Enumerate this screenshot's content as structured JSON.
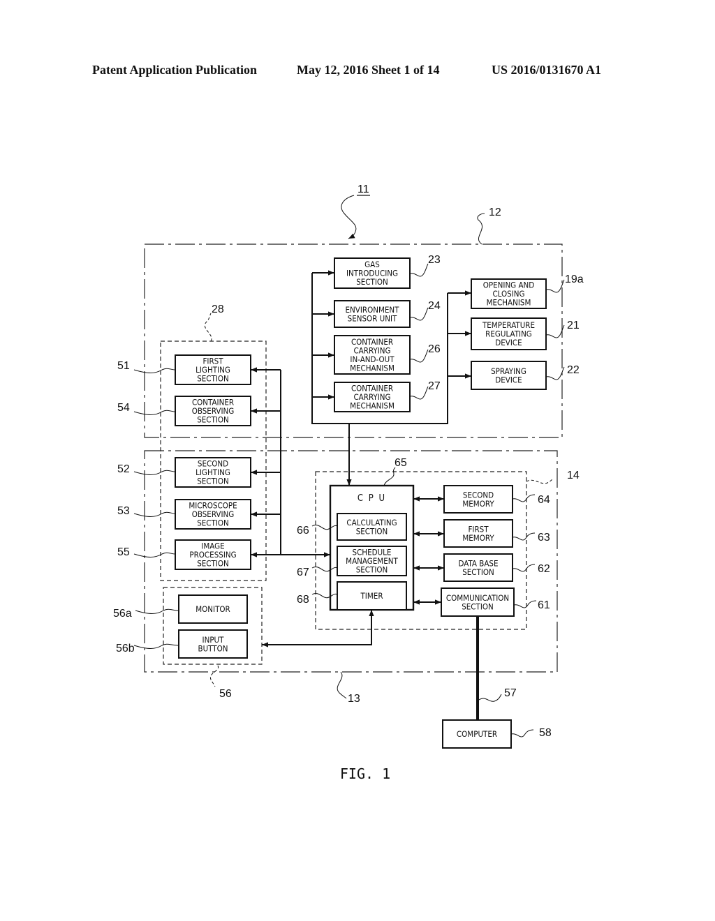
{
  "header": {
    "publication": "Patent Application Publication",
    "date_sheet": "May 12, 2016  Sheet 1 of 14",
    "number": "US 2016/0131670 A1"
  },
  "figure": {
    "caption": "FIG. 1",
    "system_ref": "11",
    "regions": [
      {
        "id": "unit-12",
        "ref": "12",
        "style": "dash-dot"
      },
      {
        "id": "unit-13",
        "ref": "13",
        "style": "dash-dot"
      },
      {
        "id": "controller-14",
        "ref": "14",
        "style": "dashed"
      },
      {
        "id": "observation-28",
        "ref": "28",
        "style": "dashed"
      },
      {
        "id": "operation-56",
        "ref": "56",
        "style": "dashed"
      }
    ],
    "blocks": [
      {
        "id": "gas",
        "ref": "23",
        "lines": [
          "GAS",
          "INTRODUCING",
          "SECTION"
        ]
      },
      {
        "id": "env",
        "ref": "24",
        "lines": [
          "ENVIRONMENT",
          "SENSOR UNIT"
        ]
      },
      {
        "id": "cio",
        "ref": "26",
        "lines": [
          "CONTAINER",
          "CARRYING",
          "IN-AND-OUT",
          "MECHANISM"
        ]
      },
      {
        "id": "cc",
        "ref": "27",
        "lines": [
          "CONTAINER",
          "CARRYING",
          "MECHANISM"
        ]
      },
      {
        "id": "open",
        "ref": "19a",
        "lines": [
          "OPENING AND",
          "CLOSING",
          "MECHANISM"
        ]
      },
      {
        "id": "temp",
        "ref": "21",
        "lines": [
          "TEMPERATURE",
          "REGULATING",
          "DEVICE"
        ]
      },
      {
        "id": "spray",
        "ref": "22",
        "lines": [
          "SPRAYING",
          "DEVICE"
        ]
      },
      {
        "id": "l1",
        "ref": "51",
        "lines": [
          "FIRST",
          "LIGHTING",
          "SECTION"
        ]
      },
      {
        "id": "cobs",
        "ref": "54",
        "lines": [
          "CONTAINER",
          "OBSERVING",
          "SECTION"
        ]
      },
      {
        "id": "l2",
        "ref": "52",
        "lines": [
          "SECOND",
          "LIGHTING",
          "SECTION"
        ]
      },
      {
        "id": "mobs",
        "ref": "53",
        "lines": [
          "MICROSCOPE",
          "OBSERVING",
          "SECTION"
        ]
      },
      {
        "id": "img",
        "ref": "55",
        "lines": [
          "IMAGE",
          "PROCESSING",
          "SECTION"
        ]
      },
      {
        "id": "mon",
        "ref": "56a",
        "lines": [
          "MONITOR"
        ]
      },
      {
        "id": "inp",
        "ref": "56b",
        "lines": [
          "INPUT",
          "BUTTON"
        ]
      },
      {
        "id": "cpu",
        "ref": "65",
        "lines": [
          "C P U"
        ]
      },
      {
        "id": "calc",
        "ref": "66",
        "lines": [
          "CALCULATING",
          "SECTION"
        ]
      },
      {
        "id": "sched",
        "ref": "67",
        "lines": [
          "SCHEDULE",
          "MANAGEMENT",
          "SECTION"
        ]
      },
      {
        "id": "timer",
        "ref": "68",
        "lines": [
          "TIMER"
        ]
      },
      {
        "id": "mem2",
        "ref": "64",
        "lines": [
          "SECOND",
          "MEMORY"
        ]
      },
      {
        "id": "mem1",
        "ref": "63",
        "lines": [
          "FIRST",
          "MEMORY"
        ]
      },
      {
        "id": "db",
        "ref": "62",
        "lines": [
          "DATA BASE",
          "SECTION"
        ]
      },
      {
        "id": "comm",
        "ref": "61",
        "lines": [
          "COMMUNICATION",
          "SECTION"
        ]
      },
      {
        "id": "pc",
        "ref": "58",
        "lines": [
          "COMPUTER"
        ]
      }
    ],
    "connections": [
      {
        "from": "cpu",
        "to": "gas",
        "ref": ""
      },
      {
        "from": "cpu",
        "to": "env",
        "ref": ""
      },
      {
        "from": "cpu",
        "to": "cio",
        "ref": ""
      },
      {
        "from": "cpu",
        "to": "cc",
        "ref": ""
      },
      {
        "from": "cpu",
        "to": "open",
        "ref": ""
      },
      {
        "from": "cpu",
        "to": "temp",
        "ref": ""
      },
      {
        "from": "cpu",
        "to": "spray",
        "ref": ""
      },
      {
        "from": "cpu",
        "to": "l1",
        "ref": ""
      },
      {
        "from": "cpu",
        "to": "cobs",
        "ref": ""
      },
      {
        "from": "cpu",
        "to": "l2",
        "ref": ""
      },
      {
        "from": "cpu",
        "to": "mobs",
        "ref": ""
      },
      {
        "from": "cpu",
        "to": "img",
        "ref": "bidirectional"
      },
      {
        "from": "cpu",
        "to": "inp",
        "ref": "bidirectional"
      },
      {
        "from": "cpu",
        "to": "mem2",
        "ref": "bidirectional"
      },
      {
        "from": "cpu",
        "to": "mem1",
        "ref": "bidirectional"
      },
      {
        "from": "cpu",
        "to": "db",
        "ref": "bidirectional"
      },
      {
        "from": "cpu",
        "to": "comm",
        "ref": "bidirectional"
      },
      {
        "from": "comm",
        "to": "pc",
        "ref": "57"
      }
    ]
  }
}
